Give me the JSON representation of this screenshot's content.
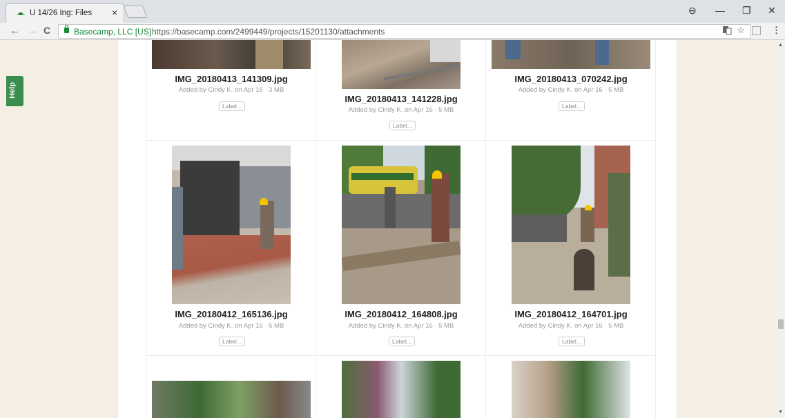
{
  "browser": {
    "tab_title": "U 14/26 Ing: Files",
    "tab_close": "×",
    "window_controls": {
      "account": "⊖",
      "minimize": "—",
      "restore": "❐",
      "close": "✕"
    },
    "nav": {
      "back": "←",
      "forward": "→",
      "reload": "C"
    },
    "security_label": "Basecamp, LLC [US]",
    "url": "https://basecamp.com/2499449/projects/15201130/attachments",
    "translate_icon": "translate-icon",
    "bookmark_star": "☆",
    "menu": "⋮"
  },
  "help_tab": "Help",
  "files": [
    {
      "name": "IMG_20180413_141309.jpg",
      "meta": "Added by Cindy K. on Apr 16 · 3 MB",
      "label": "Label..."
    },
    {
      "name": "IMG_20180413_141228.jpg",
      "meta": "Added by Cindy K. on Apr 16 · 5 MB",
      "label": "Label..."
    },
    {
      "name": "IMG_20180413_070242.jpg",
      "meta": "Added by Cindy K. on Apr 16 · 5 MB",
      "label": "Label..."
    },
    {
      "name": "IMG_20180412_165136.jpg",
      "meta": "Added by Cindy K. on Apr 16 · 5 MB",
      "label": "Label..."
    },
    {
      "name": "IMG_20180412_164808.jpg",
      "meta": "Added by Cindy K. on Apr 16 · 5 MB",
      "label": "Label..."
    },
    {
      "name": "IMG_20180412_164701.jpg",
      "meta": "Added by Cindy K. on Apr 16 · 5 MB",
      "label": "Label..."
    }
  ],
  "colors": {
    "accent_green": "#3a8d4c",
    "secure_green": "#138a36",
    "page_bg": "#f5eee4"
  }
}
